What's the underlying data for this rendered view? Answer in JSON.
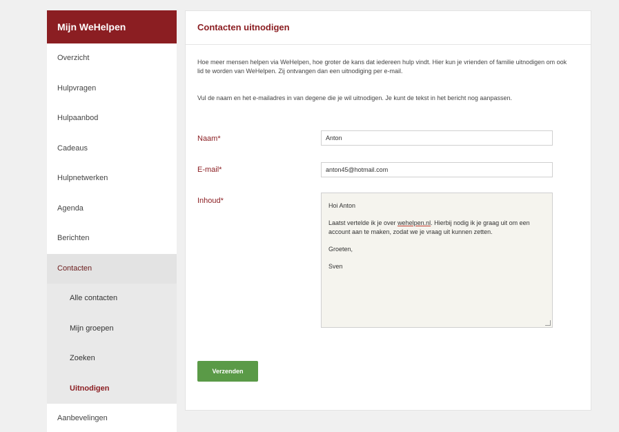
{
  "sidebar": {
    "title": "Mijn WeHelpen",
    "items": [
      {
        "label": "Overzicht"
      },
      {
        "label": "Hulpvragen"
      },
      {
        "label": "Hulpaanbod"
      },
      {
        "label": "Cadeaus"
      },
      {
        "label": "Hulpnetwerken"
      },
      {
        "label": "Agenda"
      },
      {
        "label": "Berichten"
      },
      {
        "label": "Contacten",
        "active": true
      },
      {
        "label": "Alle contacten",
        "sub": true
      },
      {
        "label": "Mijn groepen",
        "sub": true
      },
      {
        "label": "Zoeken",
        "sub": true
      },
      {
        "label": "Uitnodigen",
        "sub": true,
        "current": true
      },
      {
        "label": "Aanbevelingen"
      }
    ]
  },
  "main": {
    "title": "Contacten uitnodigen",
    "intro1": "Hoe meer mensen helpen via WeHelpen, hoe groter de kans dat iedereen hulp vindt. Hier kun je vrienden of familie uitnodigen om ook lid te worden van WeHelpen. Zij ontvangen dan een uitnodiging per e-mail.",
    "intro2": "Vul de naam en het e-mailadres in van degene die je wil uitnodigen. Je kunt de tekst in het bericht nog aanpassen.",
    "form": {
      "name_label": "Naam*",
      "name_value": "Anton",
      "email_label": "E-mail*",
      "email_value": "anton45@hotmail.com",
      "content_label": "Inhoud*",
      "content": {
        "greeting": "Hoi Anton",
        "body_before": "Laatst vertelde ik je over ",
        "body_link": "wehelpen.nl",
        "body_after": ". Hierbij nodig ik je graag uit om een account aan te maken, zodat we je vraag uit kunnen zetten.",
        "closing": "Groeten,",
        "signature": "Sven"
      },
      "submit_label": "Verzenden"
    }
  },
  "colors": {
    "brand": "#8b1e22",
    "button": "#5a9a47"
  }
}
